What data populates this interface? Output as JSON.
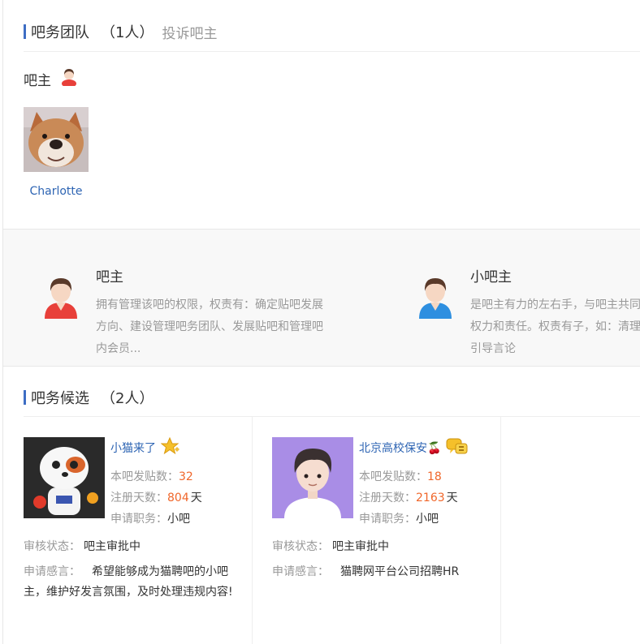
{
  "team": {
    "title": "吧务团队",
    "count": "（1人）",
    "complain_link": "投诉吧主",
    "owner_role": "吧主",
    "owner_name": "Charlotte"
  },
  "intro": [
    {
      "title": "吧主",
      "desc": "拥有管理该吧的权限，权责有：确定贴吧发展方向、建设管理吧务团队、发展贴吧和管理吧内会员..."
    },
    {
      "title": "小吧主",
      "desc": "是吧主有力的左右手，与吧主共同管理贴吧的权力和责任。权责有子，如：清理不良信息，引导言论"
    }
  ],
  "candidates_section": {
    "title": "吧务候选",
    "count": "（2人）"
  },
  "labels": {
    "posts": "本吧发贴数：",
    "days": "注册天数：",
    "days_unit": "天",
    "position": "申请职务：",
    "status": "审核状态：",
    "message": "申请感言："
  },
  "candidates": [
    {
      "name": "小猫来了",
      "posts": "32",
      "days": "804",
      "position": "小吧",
      "status": "吧主审批中",
      "message": "希望能够成为猫聘吧的小吧主，维护好发言氛围，及时处理违规内容!"
    },
    {
      "name": "北京高校保安🍒",
      "posts": "18",
      "days": "2163",
      "position": "小吧",
      "status": "吧主审批中",
      "message": "猫聘网平台公司招聘HR"
    }
  ],
  "colors": {
    "accent": "#3d6dc4",
    "link": "#2d64b3",
    "number": "#f0662a",
    "muted": "#999999"
  }
}
